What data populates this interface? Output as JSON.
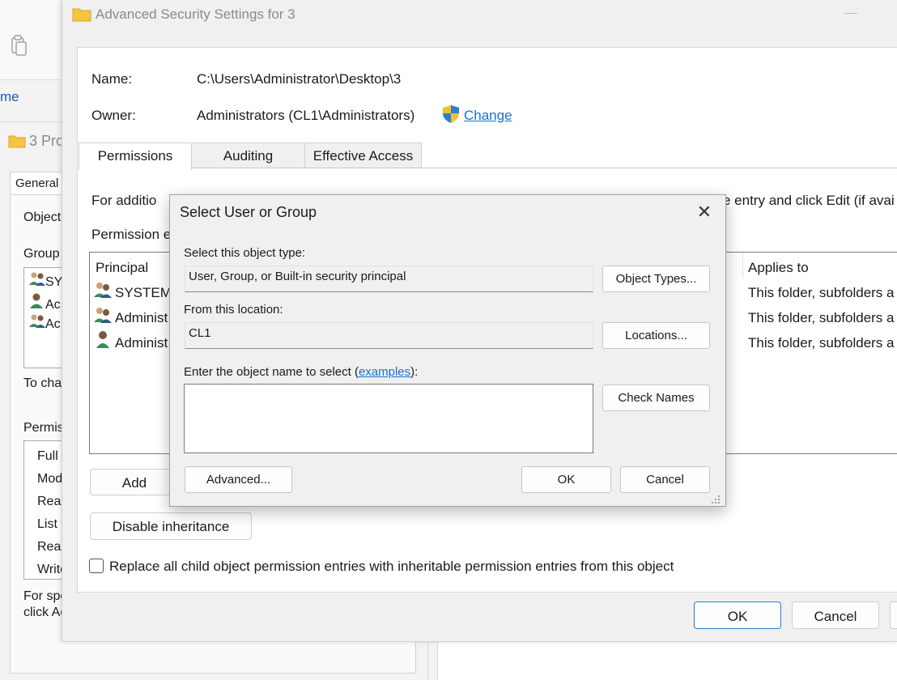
{
  "explorer": {
    "home_label": "me",
    "properties_title": "3 Pro",
    "tab_general": "General",
    "object_label": "Object",
    "group_label": "Group",
    "group_items": [
      "SY",
      "Ac",
      "Ac"
    ],
    "to_change_label": "To cha",
    "permissions_label": "Permis",
    "perm_items": [
      "Full c",
      "Mod",
      "Rea",
      "List f",
      "Rea",
      "Write"
    ],
    "special_line1": "For spe",
    "special_line2": "click Ac"
  },
  "advanced": {
    "window_title": "Advanced Security Settings for 3",
    "name_label": "Name:",
    "name_value": "C:\\Users\\Administrator\\Desktop\\3",
    "owner_label": "Owner:",
    "owner_value": "Administrators (CL1\\Administrators)",
    "change_link": "Change",
    "tabs": [
      "Permissions",
      "Auditing",
      "Effective Access"
    ],
    "info_left": "For additio",
    "info_right": "e entry and click Edit (if avai",
    "perm_entries_label": "Permission e",
    "col_principal": "Principal",
    "col_applies": "Applies to",
    "rows": [
      {
        "principal": "SYSTEM",
        "applies": "This folder, subfolders a"
      },
      {
        "principal": "Administ",
        "applies": "This folder, subfolders a"
      },
      {
        "principal": "Administ",
        "applies": "This folder, subfolders a"
      }
    ],
    "add_button": "Add",
    "disable_inheritance_button": "Disable inheritance",
    "replace_checkbox_label": "Replace all child object permission entries with inheritable permission entries from this object",
    "ok_button": "OK",
    "cancel_button": "Cancel"
  },
  "dialog": {
    "title": "Select User or Group",
    "object_type_label": "Select this object type:",
    "object_type_value": "User, Group, or Built-in security principal",
    "object_types_button": "Object Types...",
    "location_label": "From this location:",
    "location_value": "CL1",
    "locations_button": "Locations...",
    "enter_name_prefix": "Enter the object name to select (",
    "examples_link": "examples",
    "enter_name_suffix": "):",
    "name_input_value": "",
    "check_names_button": "Check Names",
    "advanced_button": "Advanced...",
    "ok_button": "OK",
    "cancel_button": "Cancel"
  },
  "colors": {
    "link": "#1a6fd1",
    "folder": "#f5c542",
    "primary_border": "#2a79c9"
  },
  "icons": [
    "folder-icon",
    "clipboard-icon",
    "shield-icon",
    "user-icon",
    "group-icon",
    "close-icon",
    "resize-grip-icon"
  ]
}
